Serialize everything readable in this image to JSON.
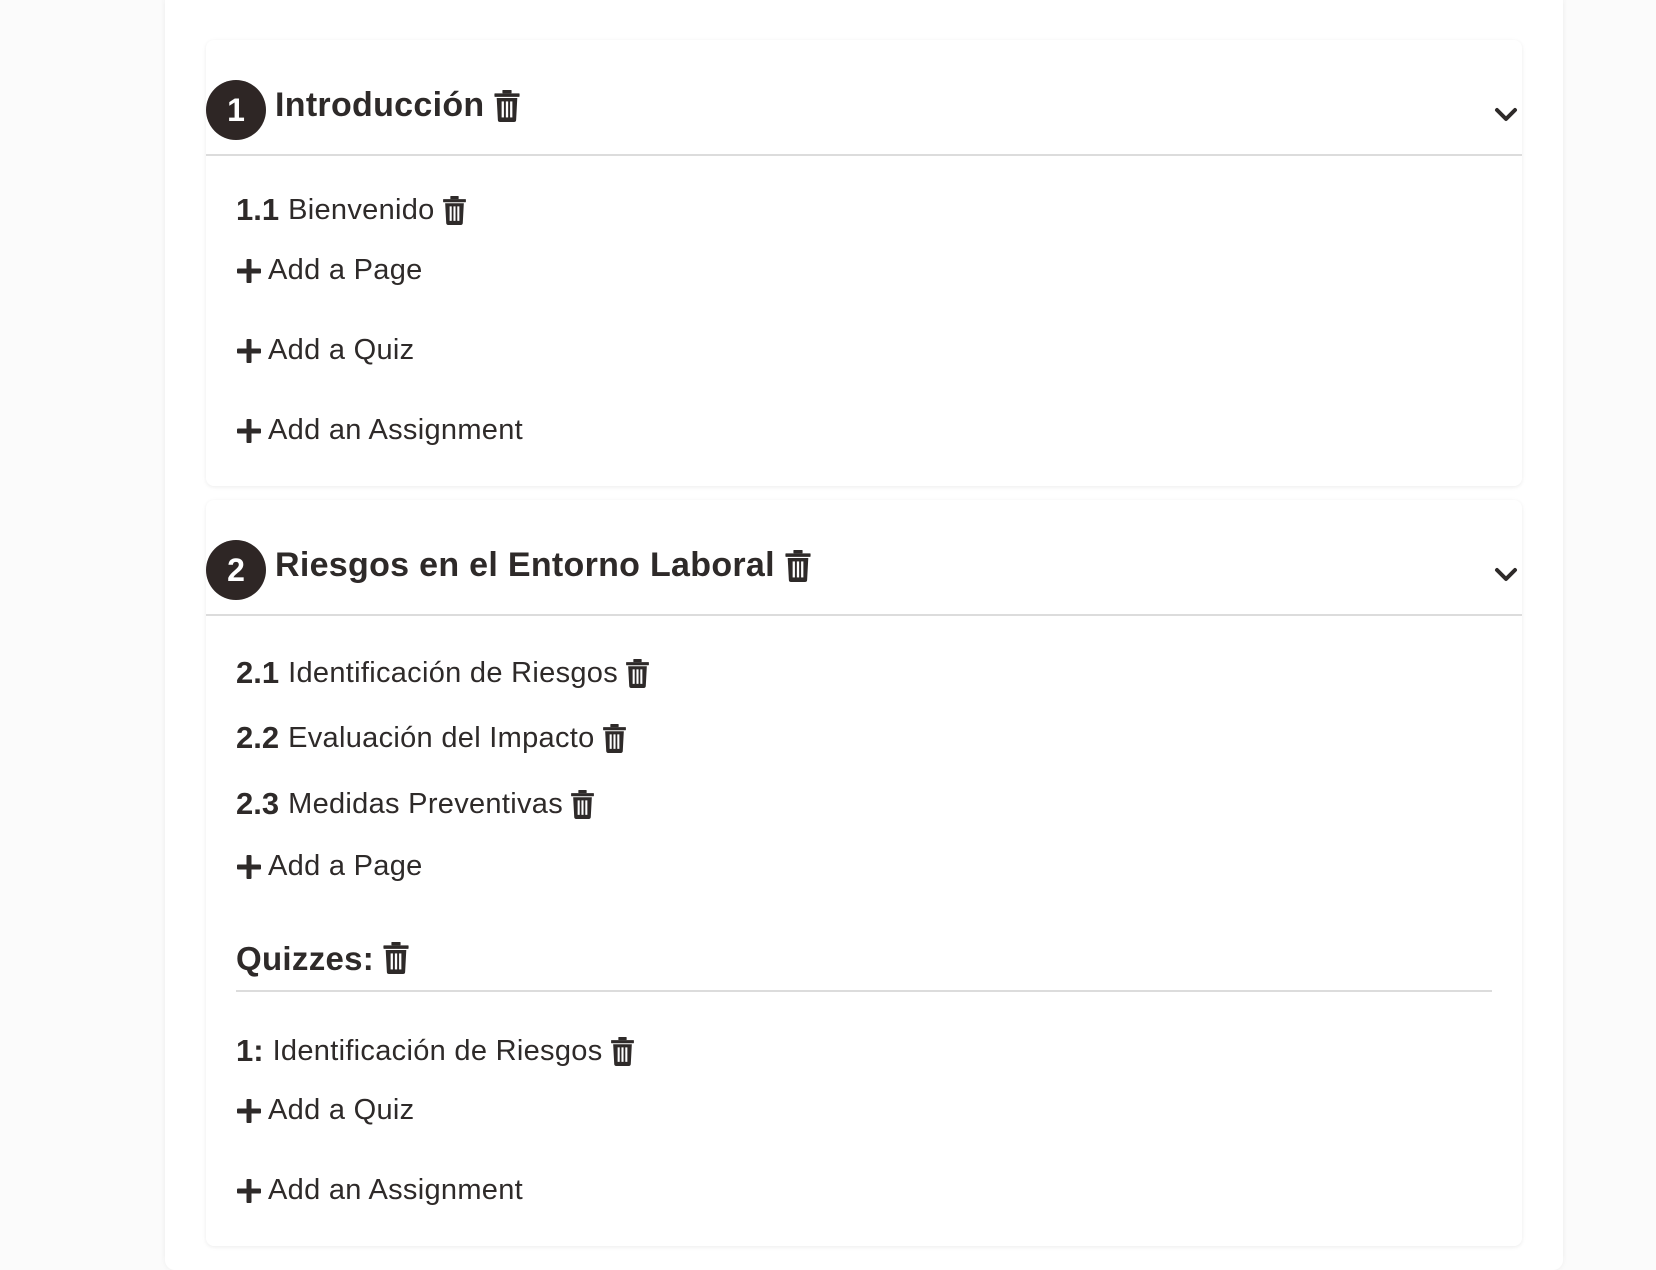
{
  "modules": [
    {
      "number": "1",
      "title": "Introducción",
      "pages": [
        {
          "number": "1.1",
          "title": "Bienvenido"
        }
      ],
      "add_page_label": "Add a Page",
      "add_quiz_label": "Add a Quiz",
      "add_assignment_label": "Add an Assignment"
    },
    {
      "number": "2",
      "title": "Riesgos en el Entorno Laboral",
      "pages": [
        {
          "number": "2.1",
          "title": "Identificación de Riesgos"
        },
        {
          "number": "2.2",
          "title": "Evaluación del Impacto"
        },
        {
          "number": "2.3",
          "title": "Medidas Preventivas"
        }
      ],
      "add_page_label": "Add a Page",
      "quizzes_heading": "Quizzes:",
      "quizzes": [
        {
          "number": "1:",
          "title": "Identificación de Riesgos"
        }
      ],
      "add_quiz_label": "Add a Quiz",
      "add_assignment_label": "Add an Assignment"
    }
  ],
  "icons": {
    "delete": "trash-icon",
    "add": "plus-icon",
    "collapse": "chevron-down-icon"
  },
  "colors": {
    "badge_bg": "#2e2625",
    "text": "#2e2a29",
    "divider": "#dcdcdc"
  }
}
